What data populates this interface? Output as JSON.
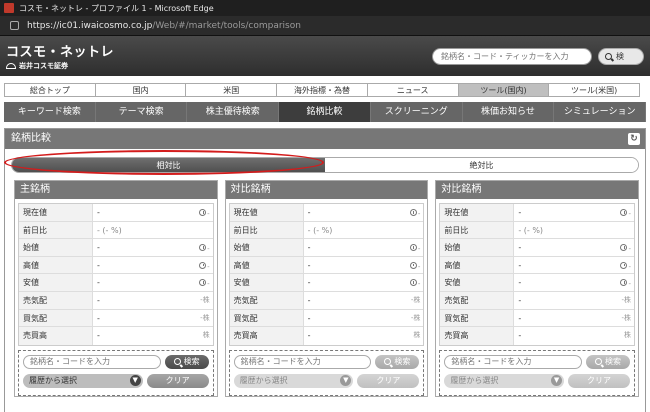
{
  "browser": {
    "title": "コスモ・ネットレ - プロファイル 1 - Microsoft Edge",
    "url_host": "https://ic01.iwaicosmo.co.jp",
    "url_path": "/Web/#/market/tools/comparison"
  },
  "brand": {
    "logo_line1": "コスモ・ネットレ",
    "logo_line2": "岩井コスモ証券",
    "search_placeholder": "銘柄名・コード・ティッカーを入力",
    "search_button": "検"
  },
  "global_nav": [
    {
      "label": "総合トップ",
      "active": false
    },
    {
      "label": "国内",
      "active": false
    },
    {
      "label": "米国",
      "active": false
    },
    {
      "label": "海外指標・為替",
      "active": false
    },
    {
      "label": "ニュース",
      "active": false
    },
    {
      "label": "ツール(国内)",
      "active": true
    },
    {
      "label": "ツール(米国)",
      "active": false
    }
  ],
  "sub_nav": [
    {
      "label": "キーワード検索",
      "active": false
    },
    {
      "label": "テーマ検索",
      "active": false
    },
    {
      "label": "株主優待検索",
      "active": false
    },
    {
      "label": "銘柄比較",
      "active": true
    },
    {
      "label": "スクリーニング",
      "active": false
    },
    {
      "label": "株価お知らせ",
      "active": false
    },
    {
      "label": "シミュレーション",
      "active": false
    }
  ],
  "panel": {
    "title": "銘柄比較",
    "toggle_relative": "相対比",
    "toggle_absolute": "絶対比"
  },
  "columns": [
    {
      "title": "主銘柄",
      "dim": false
    },
    {
      "title": "対比銘柄",
      "dim": true
    },
    {
      "title": "対比銘柄",
      "dim": true
    }
  ],
  "rows": [
    {
      "label": "現在値",
      "value": "-",
      "suffix_type": "clock",
      "suffix": "-"
    },
    {
      "label": "前日比",
      "value": "- (- %)",
      "suffix_type": "none",
      "suffix": ""
    },
    {
      "label": "始値",
      "value": "-",
      "suffix_type": "clock",
      "suffix": "-"
    },
    {
      "label": "高値",
      "value": "-",
      "suffix_type": "clock",
      "suffix": "-"
    },
    {
      "label": "安値",
      "value": "-",
      "suffix_type": "clock",
      "suffix": "-"
    },
    {
      "label": "売気配",
      "value": "-",
      "suffix_type": "unit",
      "suffix": "-株"
    },
    {
      "label": "買気配",
      "value": "-",
      "suffix_type": "unit",
      "suffix": "-株"
    },
    {
      "label": "売買高",
      "value": "-",
      "suffix_type": "unit",
      "suffix": "株"
    }
  ],
  "input_area": {
    "placeholder": "銘柄名・コードを入力",
    "search_button": "検索",
    "history_select": "履歴から選択",
    "clear_button": "クリア"
  }
}
